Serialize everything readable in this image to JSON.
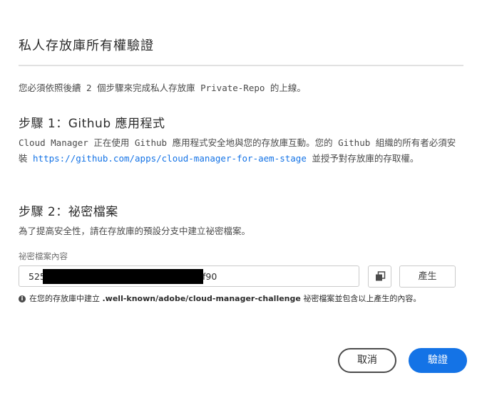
{
  "dialog": {
    "title": "私人存放庫所有權驗證",
    "intro": "您必須依照後續 2 個步驟來完成私人存放庫 Private-Repo 的上線。"
  },
  "step1": {
    "heading": "步驟 1：Github 應用程式",
    "text_before": "Cloud Manager 正在使用 Github 應用程式安全地與您的存放庫互動。您的 Github 組織的所有者必須安裝 ",
    "link": "https://github.com/apps/cloud-manager-for-aem-stage",
    "text_after": " 並授予對存放庫的存取權。"
  },
  "step2": {
    "heading": "步驟 2：祕密檔案",
    "text": "為了提高安全性，請在存放庫的預設分支中建立祕密檔案。",
    "field_label": "祕密檔案內容",
    "secret_prefix": "525",
    "secret_suffix": "f90",
    "generate_label": "產生",
    "copy_icon": "copy-icon",
    "note_before": "在您的存放庫中建立 ",
    "note_path": ".well-known/adobe/cloud-manager-challenge",
    "note_after": " 祕密檔案並包含以上產生的內容。",
    "info_icon": "info-icon"
  },
  "actions": {
    "cancel_label": "取消",
    "verify_label": "驗證"
  },
  "colors": {
    "accent": "#1473e6",
    "text": "#2c2c2c",
    "muted": "#6e6e6e",
    "border": "#cacaca"
  }
}
